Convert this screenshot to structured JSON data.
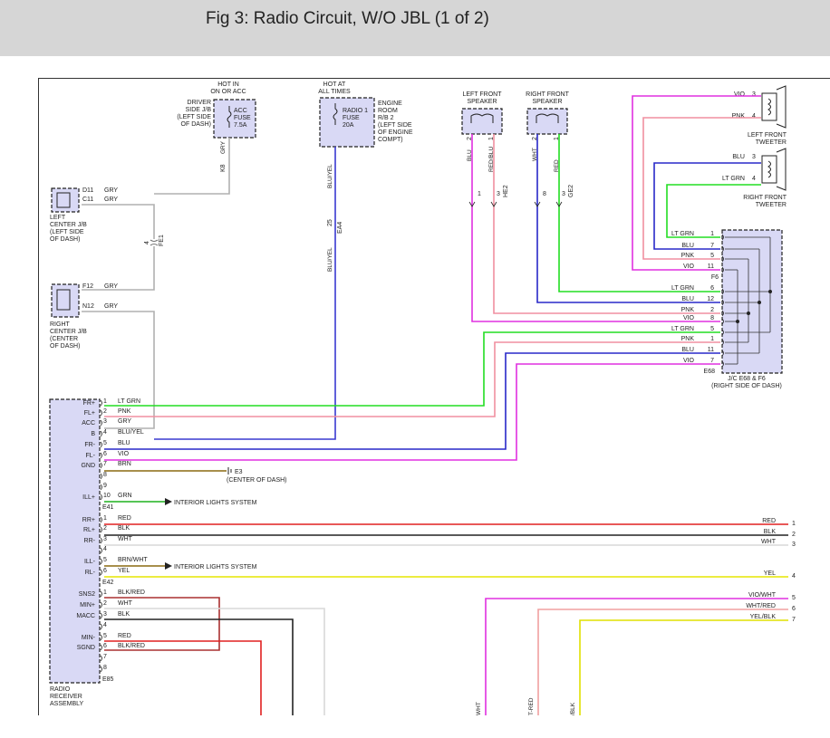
{
  "header": {
    "title": "Fig 3: Radio Circuit, W/O JBL (1 of 2)"
  },
  "colors": {
    "LT GRN": "#22dd22",
    "PNK": "#f08fa0",
    "GRY": "#b0b0b0",
    "BLU/YEL": "#3a3ad0",
    "BLU": "#2828c8",
    "VIO": "#e030e0",
    "BRN": "#8a6a10",
    "GRN": "#1fb21f",
    "RED": "#e02020",
    "BLK": "#222222",
    "WHT": "#d8d8d8",
    "BRN/WHT": "#8a6a10",
    "YEL": "#e6e600",
    "BLK/RED": "#aa3030",
    "VIO/WHT": "#e030e0",
    "WHT/RED": "#f0a0a0",
    "YEL/BLK": "#e0e000",
    "RED/BLU": "#f08fa0",
    "component_fill": "#d9d9f5"
  },
  "fuses": {
    "acc": {
      "heading": [
        "HOT IN",
        "ON OR ACC"
      ],
      "location": [
        "DRIVER",
        "SIDE J/B",
        "(LEFT SIDE",
        "OF DASH)"
      ],
      "label": [
        "ACC",
        "FUSE",
        "7.5A"
      ],
      "pin": "K8",
      "wire": "GRY"
    },
    "radio": {
      "heading": [
        "HOT AT",
        "ALL TIMES"
      ],
      "location": [
        "ENGINE",
        "ROOM",
        "R/B 2",
        "(LEFT SIDE",
        "OF ENGINE",
        "COMPT)"
      ],
      "label": [
        "RADIO 1",
        "FUSE",
        "20A"
      ],
      "pin": "25",
      "connector": "EA4",
      "wire": "BLU/YEL"
    }
  },
  "junctions": {
    "left_center": {
      "pins": [
        {
          "id": "D11",
          "wire": "GRY"
        },
        {
          "id": "C11",
          "wire": "GRY"
        }
      ],
      "label": [
        "LEFT",
        "CENTER J/B",
        "(LEFT SIDE",
        "OF DASH)"
      ],
      "splice": {
        "pin": "4",
        "connector": "FE1"
      }
    },
    "right_center": {
      "pins": [
        {
          "id": "F12",
          "wire": "GRY"
        },
        {
          "id": "N12",
          "wire": "GRY"
        }
      ],
      "label": [
        "RIGHT",
        "CENTER J/B",
        "(CENTER",
        "OF DASH)"
      ]
    }
  },
  "speakers": {
    "left_front": {
      "title": [
        "LEFT FRONT",
        "SPEAKER"
      ],
      "pins": [
        "2",
        "1"
      ],
      "wires": [
        "BLU",
        "RED/BLU"
      ],
      "bottom_pins": [
        "1",
        "3"
      ],
      "connector": "HE2"
    },
    "right_front": {
      "title": [
        "RIGHT FRONT",
        "SPEAKER"
      ],
      "pins": [
        "2",
        "1"
      ],
      "wires": [
        "WHT",
        "RED"
      ],
      "bottom_pins": [
        "8",
        "3"
      ],
      "connector": "GE2"
    }
  },
  "tweeters": {
    "left": {
      "label": [
        "LEFT FRONT",
        "TWEETER"
      ],
      "pins": [
        {
          "wire": "VIO",
          "pin": "3"
        },
        {
          "wire": "PNK",
          "pin": "4"
        }
      ]
    },
    "right": {
      "label": [
        "RIGHT FRONT",
        "TWEETER"
      ],
      "pins": [
        {
          "wire": "BLU",
          "pin": "3"
        },
        {
          "wire": "LT GRN",
          "pin": "4"
        }
      ]
    }
  },
  "jc": {
    "label": [
      "J/C E68 & F6",
      "(RIGHT SIDE OF DASH)"
    ],
    "f6_label": "F6",
    "e68_label": "E68",
    "rows": [
      {
        "wire": "LT GRN",
        "pin": "1"
      },
      {
        "wire": "BLU",
        "pin": "7"
      },
      {
        "wire": "PNK",
        "pin": "5"
      },
      {
        "wire": "VIO",
        "pin": "11"
      },
      {
        "wire": "LT GRN",
        "pin": "6"
      },
      {
        "wire": "BLU",
        "pin": "12"
      },
      {
        "wire": "PNK",
        "pin": "2"
      },
      {
        "wire": "VIO",
        "pin": "8"
      },
      {
        "wire": "LT GRN",
        "pin": "5"
      },
      {
        "wire": "PNK",
        "pin": "1"
      },
      {
        "wire": "BLU",
        "pin": "11"
      },
      {
        "wire": "VIO",
        "pin": "7"
      }
    ]
  },
  "receiver": {
    "label": [
      "RADIO",
      "RECEIVER",
      "ASSEMBLY"
    ],
    "e41": {
      "name": "E41",
      "pins": [
        {
          "term": "FR+",
          "pin": "1",
          "wire": "LT GRN"
        },
        {
          "term": "FL+",
          "pin": "2",
          "wire": "PNK"
        },
        {
          "term": "ACC",
          "pin": "3",
          "wire": "GRY"
        },
        {
          "term": "B",
          "pin": "4",
          "wire": "BLU/YEL"
        },
        {
          "term": "FR-",
          "pin": "5",
          "wire": "BLU"
        },
        {
          "term": "FL-",
          "pin": "6",
          "wire": "VIO"
        },
        {
          "term": "GND",
          "pin": "7",
          "wire": "BRN"
        },
        {
          "term": "",
          "pin": "8",
          "wire": ""
        },
        {
          "term": "",
          "pin": "9",
          "wire": ""
        },
        {
          "term": "ILL+",
          "pin": "10",
          "wire": "GRN"
        }
      ]
    },
    "e42": {
      "name": "E42",
      "pins": [
        {
          "term": "RR+",
          "pin": "1",
          "wire": "RED"
        },
        {
          "term": "RL+",
          "pin": "2",
          "wire": "BLK"
        },
        {
          "term": "RR-",
          "pin": "3",
          "wire": "WHT"
        },
        {
          "term": "",
          "pin": "4",
          "wire": ""
        },
        {
          "term": "ILL-",
          "pin": "5",
          "wire": "BRN/WHT"
        },
        {
          "term": "RL-",
          "pin": "6",
          "wire": "YEL"
        }
      ]
    },
    "e85": {
      "name": "E85",
      "pins": [
        {
          "term": "SNS2",
          "pin": "1",
          "wire": "BLK/RED"
        },
        {
          "term": "MIN+",
          "pin": "2",
          "wire": "WHT"
        },
        {
          "term": "MACC",
          "pin": "3",
          "wire": "BLK"
        },
        {
          "term": "",
          "pin": "4",
          "wire": ""
        },
        {
          "term": "MIN-",
          "pin": "5",
          "wire": "RED"
        },
        {
          "term": "SGND",
          "pin": "6",
          "wire": "BLK/RED"
        },
        {
          "term": "",
          "pin": "7",
          "wire": ""
        },
        {
          "term": "",
          "pin": "8",
          "wire": ""
        }
      ]
    }
  },
  "ground": {
    "label": "E3",
    "sub": "(CENTER OF DASH)"
  },
  "interior_lights": "INTERIOR LIGHTS SYSTEM",
  "continuations": [
    {
      "wire": "RED",
      "ref": "1"
    },
    {
      "wire": "BLK",
      "ref": "2"
    },
    {
      "wire": "WHT",
      "ref": "3"
    },
    {
      "wire": "YEL",
      "ref": "4"
    },
    {
      "wire": "VIO/WHT",
      "ref": "5"
    },
    {
      "wire": "WHT/RED",
      "ref": "6"
    },
    {
      "wire": "YEL/BLK",
      "ref": "7"
    }
  ],
  "bottom_labels": [
    "WHT",
    "T-RED",
    "/BLK"
  ]
}
